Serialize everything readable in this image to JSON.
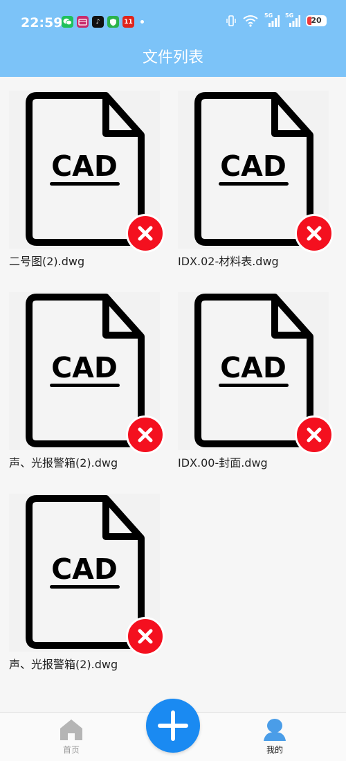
{
  "status_bar": {
    "time": "22:59",
    "apps": [
      {
        "name": "wechat-icon",
        "color": "#1fc15b",
        "glyph": ""
      },
      {
        "name": "calendar-app-icon",
        "color": "#c82b6c",
        "glyph": ""
      },
      {
        "name": "tiktok-icon",
        "color": "#111111",
        "glyph": "♪"
      },
      {
        "name": "shield-app-icon",
        "color": "#2bb24c",
        "glyph": ""
      },
      {
        "name": "taobao-11-icon",
        "color": "#e0241b",
        "glyph": "11"
      }
    ],
    "network_1": "5G",
    "network_2": "5G",
    "battery": "20"
  },
  "header": {
    "title": "文件列表"
  },
  "files": [
    {
      "badge": "CAD",
      "name": "二号图(2).dwg"
    },
    {
      "badge": "CAD",
      "name": "IDX.02-材料表.dwg"
    },
    {
      "badge": "CAD",
      "name": "声、光报警箱(2).dwg"
    },
    {
      "badge": "CAD",
      "name": "IDX.00-封面.dwg"
    },
    {
      "badge": "CAD",
      "name": "声、光报警箱(2).dwg"
    }
  ],
  "tabbar": {
    "home_label": "首页",
    "mine_label": "我的",
    "home_color": "#b5b5b5",
    "active_color": "#4a9de8"
  }
}
